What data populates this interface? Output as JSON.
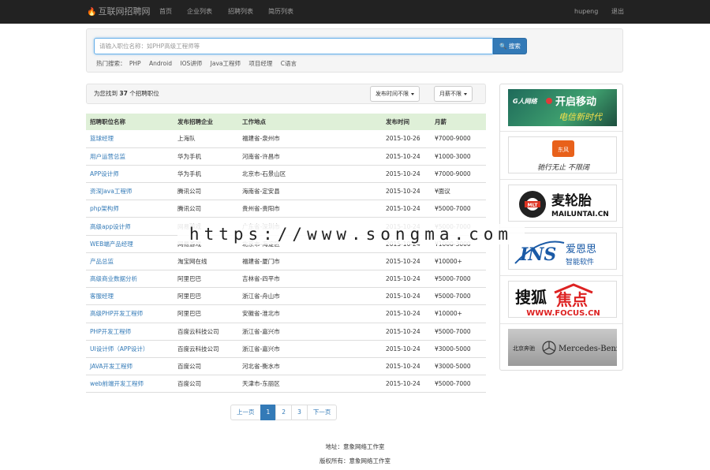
{
  "nav": {
    "brand": "互联网招聘网",
    "links": [
      "首页",
      "企业列表",
      "招聘列表",
      "简历列表"
    ],
    "user": "hupeng",
    "logout": "退出"
  },
  "search": {
    "placeholder": "请输入职位名称：如PHP高级工程师等",
    "button": "搜索",
    "hot_label": "热门搜索：",
    "hot_terms": [
      "PHP",
      "Android",
      "IOS讲师",
      "Java工程师",
      "项目经理",
      "C语言"
    ]
  },
  "results": {
    "prefix": "为您找到",
    "count": "37",
    "suffix": "个招聘职位",
    "filter_time": "发布时间不限",
    "filter_salary": "月薪不限"
  },
  "table": {
    "headers": [
      "招聘职位名称",
      "发布招聘企业",
      "工作地点",
      "发布时间",
      "月薪"
    ],
    "rows": [
      [
        "篮球经理",
        "上海队",
        "福建省-泉州市",
        "2015-10-26",
        "¥7000-9000"
      ],
      [
        "用户运营总监",
        "华为手机",
        "河南省-许昌市",
        "2015-10-24",
        "¥1000-3000"
      ],
      [
        "APP设计师",
        "华为手机",
        "北京市-石景山区",
        "2015-10-24",
        "¥7000-9000"
      ],
      [
        "资深Java工程师",
        "腾讯公司",
        "海南省-定安县",
        "2015-10-24",
        "¥面议"
      ],
      [
        "php架构师",
        "腾讯公司",
        "贵州省-贵阳市",
        "2015-10-24",
        "¥5000-7000"
      ],
      [
        "高级app设计师",
        "网易游戏",
        "广东省-深圳市",
        "2015-10-24",
        "¥5000-7000"
      ],
      [
        "WEB端产品经理",
        "网易游戏",
        "北京市-海淀区",
        "2015-10-24",
        "¥1000-3000"
      ],
      [
        "产品总监",
        "淘宝网在线",
        "福建省-厦门市",
        "2015-10-24",
        "¥10000+"
      ],
      [
        "高级商业数据分析",
        "阿里巴巴",
        "吉林省-四平市",
        "2015-10-24",
        "¥5000-7000"
      ],
      [
        "客服经理",
        "阿里巴巴",
        "浙江省-舟山市",
        "2015-10-24",
        "¥5000-7000"
      ],
      [
        "高级PHP开发工程师",
        "阿里巴巴",
        "安徽省-淮北市",
        "2015-10-24",
        "¥10000+"
      ],
      [
        "PHP开发工程师",
        "百度云科技公司",
        "浙江省-嘉兴市",
        "2015-10-24",
        "¥5000-7000"
      ],
      [
        "UI设计师（APP设计）",
        "百度云科技公司",
        "浙江省-嘉兴市",
        "2015-10-24",
        "¥3000-5000"
      ],
      [
        "JAVA开发工程师",
        "百度公司",
        "河北省-衡水市",
        "2015-10-24",
        "¥3000-5000"
      ],
      [
        "web前端开发工程师",
        "百度公司",
        "天津市-东丽区",
        "2015-10-24",
        "¥5000-7000"
      ]
    ]
  },
  "pagination": {
    "prev": "上一页",
    "pages": [
      "1",
      "2",
      "3"
    ],
    "active": "1",
    "next": "下一页"
  },
  "footer": {
    "address": "地址：意象网络工作室",
    "copyright": "版权所有：意象网络工作室"
  },
  "ads": [
    {
      "name": "mobile-ad",
      "text": "开启移动 电信新时代"
    },
    {
      "name": "dongfeng-ad",
      "text": "东风 驰行无止 不限阔"
    },
    {
      "name": "mailuntai-ad",
      "text": "麦轮胎 MAILUNTAI.CN"
    },
    {
      "name": "ins-ad",
      "text": "INS 爱恩思 智能软件"
    },
    {
      "name": "focus-ad",
      "text": "搜狐焦点 WWW.FOCUS.CN"
    },
    {
      "name": "mercedes-ad",
      "text": "北京奔驰 Mercedes-Benz"
    }
  ],
  "watermark": "https://www.songma.com"
}
